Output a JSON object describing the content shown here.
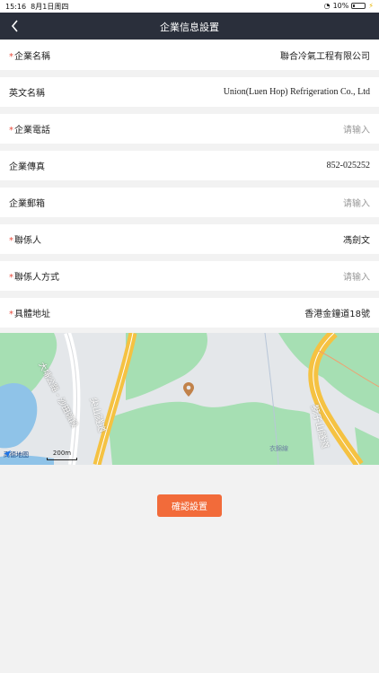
{
  "status": {
    "time": "15:16",
    "date": "8月1日周四",
    "battery": "10%"
  },
  "header": {
    "title": "企業信息設置",
    "back_icon": "chevron-left-icon"
  },
  "fields": [
    {
      "label": "企業名稱",
      "required": true,
      "value": "聯合冷氣工程有限公司",
      "placeholder": ""
    },
    {
      "label": "英文名稱",
      "required": false,
      "value": "Union(Luen Hop) Refrigeration Co., Ltd",
      "placeholder": ""
    },
    {
      "label": "企業電話",
      "required": true,
      "value": "",
      "placeholder": "请输入"
    },
    {
      "label": "企業傳真",
      "required": false,
      "value": "852-025252",
      "placeholder": ""
    },
    {
      "label": "企業郵箱",
      "required": false,
      "value": "",
      "placeholder": "请输入"
    },
    {
      "label": "聯係人",
      "required": true,
      "value": "馮劍文",
      "placeholder": ""
    },
    {
      "label": "聯係人方式",
      "required": true,
      "value": "",
      "placeholder": "请输入"
    },
    {
      "label": "具體地址",
      "required": true,
      "value": "香港金鐘道18號",
      "placeholder": ""
    }
  ],
  "map": {
    "road_labels": [
      "大埔公路 - 沙田嶺段",
      "尖山隧道",
      "獅子山隧道",
      "衣錦線"
    ],
    "logo_text": "高德地图",
    "scale_text": "200m",
    "colors": {
      "land": "#e4e7ea",
      "green": "#a6dfb3",
      "water": "#8fc3e8",
      "highway": "#f5c242"
    }
  },
  "actions": {
    "confirm_label": "確認設置",
    "accent": "#f26b3a"
  }
}
